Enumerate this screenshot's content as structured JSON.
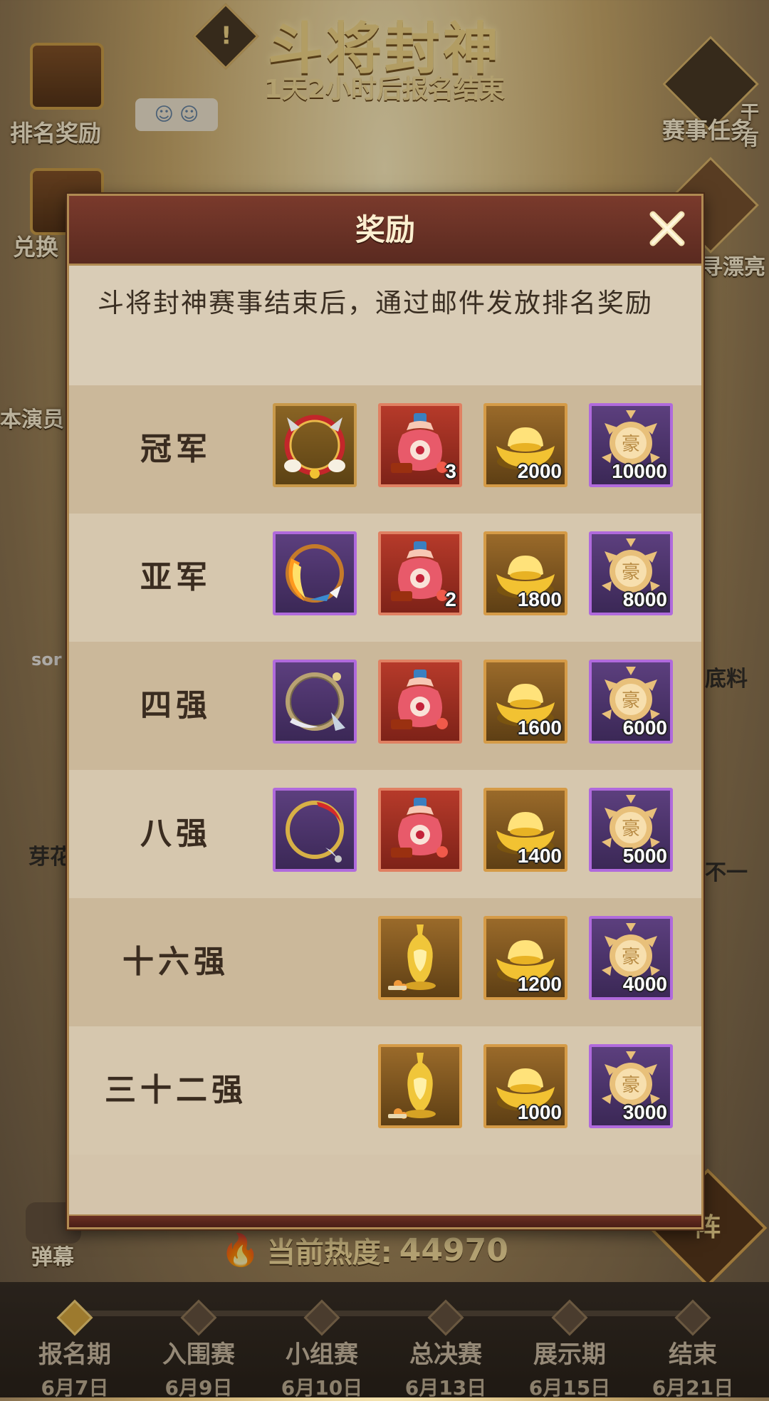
{
  "background": {
    "event_title": "斗将封神",
    "countdown": "1天2小时后报名结束",
    "left_top_label": "排名奖励",
    "left_mid_label": "兑换",
    "right_top_label": "赛事任务",
    "right_top_corner": "干有",
    "right_mid_label": "寻漂亮",
    "left_side_label": "本演员",
    "side_text_1": "sor",
    "side_text_2": "底料",
    "side_text_3": "芽花",
    "side_text_4": "不一",
    "danmu_label": "弹幕",
    "lineup_label": "阵",
    "heat_label": "当前热度:",
    "heat_value": "44970"
  },
  "timeline": {
    "stages": [
      {
        "name": "报名期",
        "date": "6月7日",
        "active": true
      },
      {
        "name": "入围赛",
        "date": "6月9日",
        "active": false
      },
      {
        "name": "小组赛",
        "date": "6月10日",
        "active": false
      },
      {
        "name": "总决赛",
        "date": "6月13日",
        "active": false
      },
      {
        "name": "展示期",
        "date": "6月15日",
        "active": false
      },
      {
        "name": "结束",
        "date": "6月21日",
        "active": false
      }
    ]
  },
  "modal": {
    "title": "奖励",
    "description": "斗将封神赛事结束后，通过邮件发放排名奖励",
    "tiers": [
      {
        "rank": "冠军",
        "items": [
          {
            "icon": "champion-frame-icon",
            "qty": ""
          },
          {
            "icon": "red-gourd-bag-icon",
            "qty": "3"
          },
          {
            "icon": "gold-ingot-icon",
            "qty": "2000"
          },
          {
            "icon": "coin-medal-icon",
            "qty": "10000"
          }
        ]
      },
      {
        "rank": "亚军",
        "items": [
          {
            "icon": "runner-up-frame-icon",
            "qty": ""
          },
          {
            "icon": "red-gourd-bag-icon",
            "qty": "2"
          },
          {
            "icon": "gold-ingot-icon",
            "qty": "1800"
          },
          {
            "icon": "coin-medal-icon",
            "qty": "8000"
          }
        ]
      },
      {
        "rank": "四强",
        "items": [
          {
            "icon": "top4-frame-icon",
            "qty": ""
          },
          {
            "icon": "red-gourd-bag-icon",
            "qty": ""
          },
          {
            "icon": "gold-ingot-icon",
            "qty": "1600"
          },
          {
            "icon": "coin-medal-icon",
            "qty": "6000"
          }
        ]
      },
      {
        "rank": "八强",
        "items": [
          {
            "icon": "top8-frame-icon",
            "qty": ""
          },
          {
            "icon": "red-gourd-bag-icon",
            "qty": ""
          },
          {
            "icon": "gold-ingot-icon",
            "qty": "1400"
          },
          {
            "icon": "coin-medal-icon",
            "qty": "5000"
          }
        ]
      },
      {
        "rank": "十六强",
        "items": [
          {
            "icon": "gold-vase-icon",
            "qty": ""
          },
          {
            "icon": "gold-ingot-icon",
            "qty": "1200"
          },
          {
            "icon": "coin-medal-icon",
            "qty": "4000"
          }
        ]
      },
      {
        "rank": "三十二强",
        "items": [
          {
            "icon": "gold-vase-icon",
            "qty": ""
          },
          {
            "icon": "gold-ingot-icon",
            "qty": "1000"
          },
          {
            "icon": "coin-medal-icon",
            "qty": "3000"
          }
        ]
      }
    ]
  },
  "colors": {
    "header_bg": "#6a3226",
    "panel_bg": "#d4c4ab",
    "frame_gold": "#b08a52",
    "rarity_gold": "#c9994a",
    "rarity_red": "#e08062",
    "rarity_purple": "#b06adc"
  }
}
